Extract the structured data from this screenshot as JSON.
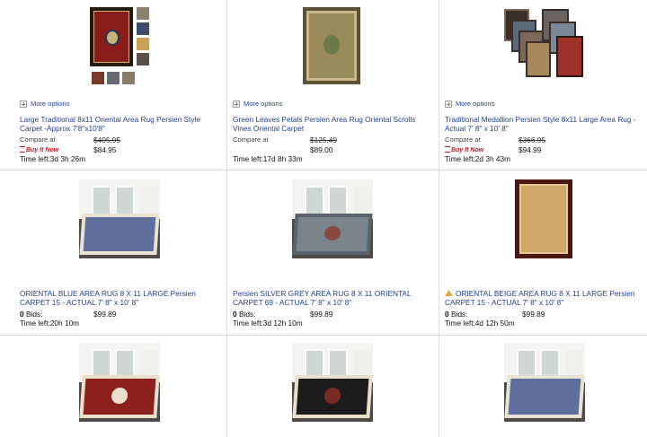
{
  "listings": [
    {
      "more_options": "More options",
      "title": "Large Traditional 8x11 Oriental Area Rug Persien Style Carpet -Approx 7'8\"x10'8\"",
      "compare_label": "Compare at",
      "compare_price": "$405.95",
      "buy_it_now": "Buy It Now",
      "price": "$84.95",
      "time_left": "Time left:3d 3h 26m",
      "colors": {
        "field": "#8a1d1a",
        "border": "#2a1b12",
        "medallion": "#c9b27a"
      }
    },
    {
      "more_options": "More options",
      "title": "Green Leaves Petals Persien Area Rug Oriental Scrolls Vines Oriental Carpet",
      "compare_label": "Compare at",
      "compare_price": "$125.49",
      "price": "$89.00",
      "time_left": "Time left:17d 8h 33m",
      "colors": {
        "field": "#9a8a5a",
        "border": "#5e5236",
        "medallion": "#6f7a4a"
      }
    },
    {
      "more_options": "More options",
      "title": "Traditional Medallion Persien Style 8x11 Large Area Rug - Actual 7' 8\" x 10' 8\"",
      "compare_label": "Compare at",
      "compare_price": "$366.95",
      "buy_it_now": "Buy It Now",
      "price": "$94.99",
      "time_left": "Time left:2d 3h 43m",
      "colors": {
        "field": "#7b6a5c",
        "border": "#3c2f29",
        "medallion": "#a03028"
      }
    },
    {
      "title": "ORIENTAL BLUE AREA RUG 8 X 11 LARGE Persien CARPET 15 - ACTUAL 7' 8\" x 10' 8\"",
      "bids_count": "0",
      "bids_label": "Bids:",
      "price": "$99.89",
      "time_left": "Time left:20h 10m",
      "colors": {
        "field": "#5e6f9e",
        "border": "#e8e2d2",
        "medallion": "#5e6f9e"
      }
    },
    {
      "title": "Persien SILVER GREY AREA RUG 8 X 11 ORIENTAL CARPET 69 - ACTUAL 7' 8\" x 10' 8\"",
      "bids_count": "0",
      "bids_label": "Bids:",
      "price": "$99.89",
      "time_left": "Time left:3d 12h 10m",
      "colors": {
        "field": "#7a848c",
        "border": "#5b646c",
        "medallion": "#8a4a40"
      }
    },
    {
      "title": "ORIENTAL BEIGE AREA RUG 8 X 11 LARGE Persien CARPET 15 - ACTUAL 7' 8\" x 10' 8\"",
      "bids_count": "0",
      "bids_label": "Bids:",
      "price": "$99.89",
      "time_left": "Time left:4d 12h 50m",
      "colors": {
        "field": "#d2a86a",
        "border": "#4a1812",
        "medallion": "#d2a86a"
      }
    },
    {
      "colors": {
        "field": "#8e1f1f",
        "border": "#e9e0cc",
        "medallion": "#e9e0cc"
      }
    },
    {
      "colors": {
        "field": "#1c1c1c",
        "border": "#e9e0cc",
        "medallion": "#7a2a22"
      }
    },
    {
      "colors": {
        "field": "#5e6f9e",
        "border": "#e8e2d2",
        "medallion": "#5e6f9e"
      }
    }
  ]
}
